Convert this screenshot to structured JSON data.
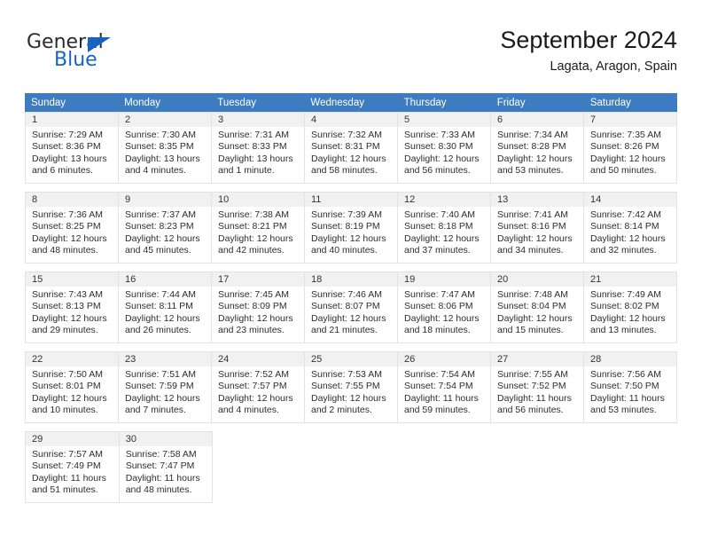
{
  "branding": {
    "name_primary": "General",
    "name_secondary": "Blue"
  },
  "header": {
    "title": "September 2024",
    "location": "Lagata, Aragon, Spain"
  },
  "colors": {
    "header_row_background": "#3d7cc0",
    "header_row_text": "#ffffff",
    "day_number_background": "#f1f1f1",
    "cell_border": "#e2e2e2",
    "brand_blue": "#1565c0"
  },
  "weekdays": [
    "Sunday",
    "Monday",
    "Tuesday",
    "Wednesday",
    "Thursday",
    "Friday",
    "Saturday"
  ],
  "weeks": [
    [
      {
        "day": "1",
        "sunrise": "Sunrise: 7:29 AM",
        "sunset": "Sunset: 8:36 PM",
        "daylight": "Daylight: 13 hours and 6 minutes."
      },
      {
        "day": "2",
        "sunrise": "Sunrise: 7:30 AM",
        "sunset": "Sunset: 8:35 PM",
        "daylight": "Daylight: 13 hours and 4 minutes."
      },
      {
        "day": "3",
        "sunrise": "Sunrise: 7:31 AM",
        "sunset": "Sunset: 8:33 PM",
        "daylight": "Daylight: 13 hours and 1 minute."
      },
      {
        "day": "4",
        "sunrise": "Sunrise: 7:32 AM",
        "sunset": "Sunset: 8:31 PM",
        "daylight": "Daylight: 12 hours and 58 minutes."
      },
      {
        "day": "5",
        "sunrise": "Sunrise: 7:33 AM",
        "sunset": "Sunset: 8:30 PM",
        "daylight": "Daylight: 12 hours and 56 minutes."
      },
      {
        "day": "6",
        "sunrise": "Sunrise: 7:34 AM",
        "sunset": "Sunset: 8:28 PM",
        "daylight": "Daylight: 12 hours and 53 minutes."
      },
      {
        "day": "7",
        "sunrise": "Sunrise: 7:35 AM",
        "sunset": "Sunset: 8:26 PM",
        "daylight": "Daylight: 12 hours and 50 minutes."
      }
    ],
    [
      {
        "day": "8",
        "sunrise": "Sunrise: 7:36 AM",
        "sunset": "Sunset: 8:25 PM",
        "daylight": "Daylight: 12 hours and 48 minutes."
      },
      {
        "day": "9",
        "sunrise": "Sunrise: 7:37 AM",
        "sunset": "Sunset: 8:23 PM",
        "daylight": "Daylight: 12 hours and 45 minutes."
      },
      {
        "day": "10",
        "sunrise": "Sunrise: 7:38 AM",
        "sunset": "Sunset: 8:21 PM",
        "daylight": "Daylight: 12 hours and 42 minutes."
      },
      {
        "day": "11",
        "sunrise": "Sunrise: 7:39 AM",
        "sunset": "Sunset: 8:19 PM",
        "daylight": "Daylight: 12 hours and 40 minutes."
      },
      {
        "day": "12",
        "sunrise": "Sunrise: 7:40 AM",
        "sunset": "Sunset: 8:18 PM",
        "daylight": "Daylight: 12 hours and 37 minutes."
      },
      {
        "day": "13",
        "sunrise": "Sunrise: 7:41 AM",
        "sunset": "Sunset: 8:16 PM",
        "daylight": "Daylight: 12 hours and 34 minutes."
      },
      {
        "day": "14",
        "sunrise": "Sunrise: 7:42 AM",
        "sunset": "Sunset: 8:14 PM",
        "daylight": "Daylight: 12 hours and 32 minutes."
      }
    ],
    [
      {
        "day": "15",
        "sunrise": "Sunrise: 7:43 AM",
        "sunset": "Sunset: 8:13 PM",
        "daylight": "Daylight: 12 hours and 29 minutes."
      },
      {
        "day": "16",
        "sunrise": "Sunrise: 7:44 AM",
        "sunset": "Sunset: 8:11 PM",
        "daylight": "Daylight: 12 hours and 26 minutes."
      },
      {
        "day": "17",
        "sunrise": "Sunrise: 7:45 AM",
        "sunset": "Sunset: 8:09 PM",
        "daylight": "Daylight: 12 hours and 23 minutes."
      },
      {
        "day": "18",
        "sunrise": "Sunrise: 7:46 AM",
        "sunset": "Sunset: 8:07 PM",
        "daylight": "Daylight: 12 hours and 21 minutes."
      },
      {
        "day": "19",
        "sunrise": "Sunrise: 7:47 AM",
        "sunset": "Sunset: 8:06 PM",
        "daylight": "Daylight: 12 hours and 18 minutes."
      },
      {
        "day": "20",
        "sunrise": "Sunrise: 7:48 AM",
        "sunset": "Sunset: 8:04 PM",
        "daylight": "Daylight: 12 hours and 15 minutes."
      },
      {
        "day": "21",
        "sunrise": "Sunrise: 7:49 AM",
        "sunset": "Sunset: 8:02 PM",
        "daylight": "Daylight: 12 hours and 13 minutes."
      }
    ],
    [
      {
        "day": "22",
        "sunrise": "Sunrise: 7:50 AM",
        "sunset": "Sunset: 8:01 PM",
        "daylight": "Daylight: 12 hours and 10 minutes."
      },
      {
        "day": "23",
        "sunrise": "Sunrise: 7:51 AM",
        "sunset": "Sunset: 7:59 PM",
        "daylight": "Daylight: 12 hours and 7 minutes."
      },
      {
        "day": "24",
        "sunrise": "Sunrise: 7:52 AM",
        "sunset": "Sunset: 7:57 PM",
        "daylight": "Daylight: 12 hours and 4 minutes."
      },
      {
        "day": "25",
        "sunrise": "Sunrise: 7:53 AM",
        "sunset": "Sunset: 7:55 PM",
        "daylight": "Daylight: 12 hours and 2 minutes."
      },
      {
        "day": "26",
        "sunrise": "Sunrise: 7:54 AM",
        "sunset": "Sunset: 7:54 PM",
        "daylight": "Daylight: 11 hours and 59 minutes."
      },
      {
        "day": "27",
        "sunrise": "Sunrise: 7:55 AM",
        "sunset": "Sunset: 7:52 PM",
        "daylight": "Daylight: 11 hours and 56 minutes."
      },
      {
        "day": "28",
        "sunrise": "Sunrise: 7:56 AM",
        "sunset": "Sunset: 7:50 PM",
        "daylight": "Daylight: 11 hours and 53 minutes."
      }
    ],
    [
      {
        "day": "29",
        "sunrise": "Sunrise: 7:57 AM",
        "sunset": "Sunset: 7:49 PM",
        "daylight": "Daylight: 11 hours and 51 minutes."
      },
      {
        "day": "30",
        "sunrise": "Sunrise: 7:58 AM",
        "sunset": "Sunset: 7:47 PM",
        "daylight": "Daylight: 11 hours and 48 minutes."
      },
      null,
      null,
      null,
      null,
      null
    ]
  ]
}
